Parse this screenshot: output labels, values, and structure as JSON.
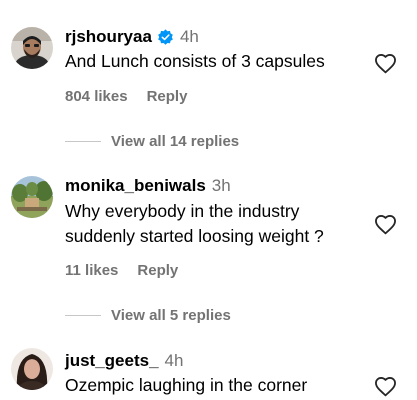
{
  "comments": [
    {
      "username": "rjshouryaa",
      "verified": true,
      "time": "4h",
      "text": "And Lunch consists of 3 capsules",
      "likes": "804 likes",
      "reply_label": "Reply",
      "view_replies": "View all 14 replies",
      "avatar": "avatar-man-with-beard"
    },
    {
      "username": "monika_beniwals",
      "verified": false,
      "time": "3h",
      "text": "Why everybody in the industry suddenly started loosing weight ?",
      "likes": "11 likes",
      "reply_label": "Reply",
      "view_replies": "View all 5 replies",
      "avatar": "avatar-outdoor-scene"
    },
    {
      "username": "just_geets_",
      "verified": false,
      "time": "4h",
      "text": "Ozempic laughing in the corner",
      "avatar": "avatar-woman-portrait"
    }
  ],
  "icons": {
    "like": "heart-outline-icon",
    "verified": "verified-badge-icon"
  },
  "colors": {
    "text": "#000000",
    "secondary": "#737373",
    "verified": "#0095f6",
    "divider": "#c7c7c7"
  }
}
